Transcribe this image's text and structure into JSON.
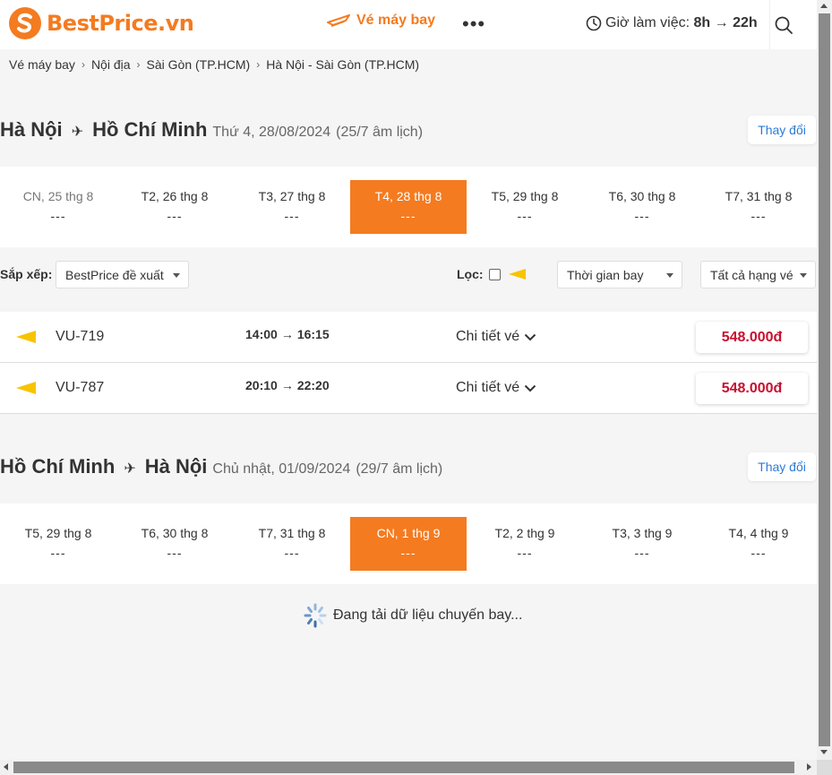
{
  "colors": {
    "brand": "#f47b20",
    "price": "#c8102e",
    "link": "#2a7bd4"
  },
  "header": {
    "logo_text": "BestPrice.vn",
    "nav_flight_label": "Vé máy bay",
    "more_label": "•••",
    "hours_prefix": "Giờ làm việc:",
    "hours_open": "8h",
    "hours_arrow": "→",
    "hours_close": "22h"
  },
  "breadcrumb": {
    "items": [
      "Vé máy bay",
      "Nội địa",
      "Sài Gòn (TP.HCM)",
      "Hà Nội - Sài Gòn (TP.HCM)"
    ],
    "separator": "›"
  },
  "outbound": {
    "from": "Hà Nội",
    "to": "Hồ Chí Minh",
    "date": "Thứ 4, 28/08/2024",
    "lunar": "(25/7 âm lịch)",
    "change_label": "Thay đổi",
    "dates": [
      {
        "label": "CN, 25 thg 8",
        "price": "---"
      },
      {
        "label": "T2, 26 thg 8",
        "price": "---"
      },
      {
        "label": "T3, 27 thg 8",
        "price": "---"
      },
      {
        "label": "T4, 28 thg 8",
        "price": "---"
      },
      {
        "label": "T5, 29 thg 8",
        "price": "---"
      },
      {
        "label": "T6, 30 thg 8",
        "price": "---"
      },
      {
        "label": "T7, 31 thg 8",
        "price": "---"
      }
    ],
    "active_index": 3
  },
  "filters": {
    "sort_label": "Sắp xếp:",
    "sort_value": "BestPrice đề xuất",
    "filter_label": "Lọc:",
    "time_value": "Thời gian bay",
    "class_value": "Tất cả hạng vé"
  },
  "flights": [
    {
      "code": "VU-719",
      "depart": "14:00",
      "arrow": "→",
      "arrive": "16:15",
      "detail": "Chi tiết vé",
      "price": "548.000đ"
    },
    {
      "code": "VU-787",
      "depart": "20:10",
      "arrow": "→",
      "arrive": "22:20",
      "detail": "Chi tiết vé",
      "price": "548.000đ"
    }
  ],
  "return": {
    "from": "Hồ Chí Minh",
    "to": "Hà Nội",
    "date": "Chủ nhật, 01/09/2024",
    "lunar": "(29/7 âm lịch)",
    "change_label": "Thay đổi",
    "dates": [
      {
        "label": "T5, 29 thg 8",
        "price": "---"
      },
      {
        "label": "T6, 30 thg 8",
        "price": "---"
      },
      {
        "label": "T7, 31 thg 8",
        "price": "---"
      },
      {
        "label": "CN, 1 thg 9",
        "price": "---"
      },
      {
        "label": "T2, 2 thg 9",
        "price": "---"
      },
      {
        "label": "T3, 3 thg 9",
        "price": "---"
      },
      {
        "label": "T4, 4 thg 9",
        "price": "---"
      }
    ],
    "active_index": 3
  },
  "loading_text": "Đang tải dữ liệu chuyến bay..."
}
